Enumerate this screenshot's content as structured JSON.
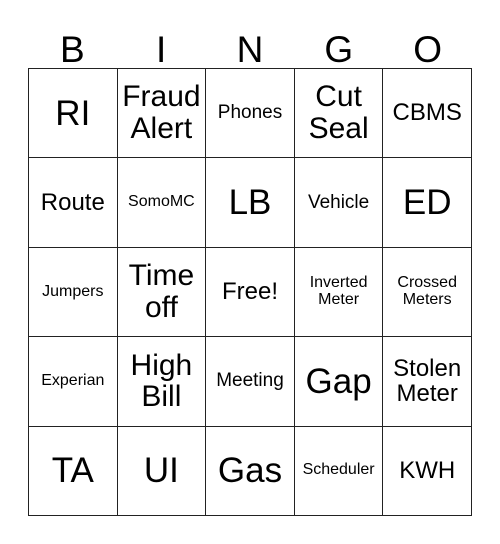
{
  "card": {
    "header_letters": [
      "B",
      "I",
      "N",
      "G",
      "O"
    ],
    "rows": [
      [
        {
          "text": "RI",
          "size": "fs-xl"
        },
        {
          "text": "Fraud\nAlert",
          "size": "fs-lg"
        },
        {
          "text": "Phones",
          "size": "fs-sm"
        },
        {
          "text": "Cut\nSeal",
          "size": "fs-lg"
        },
        {
          "text": "CBMS",
          "size": "fs-md"
        }
      ],
      [
        {
          "text": "Route",
          "size": "fs-md"
        },
        {
          "text": "SomoMC",
          "size": "fs-xs"
        },
        {
          "text": "LB",
          "size": "fs-xl"
        },
        {
          "text": "Vehicle",
          "size": "fs-sm"
        },
        {
          "text": "ED",
          "size": "fs-xl"
        }
      ],
      [
        {
          "text": "Jumpers",
          "size": "fs-xs"
        },
        {
          "text": "Time\noff",
          "size": "fs-lg"
        },
        {
          "text": "Free!",
          "size": "fs-md"
        },
        {
          "text": "Inverted\nMeter",
          "size": "fs-xs"
        },
        {
          "text": "Crossed\nMeters",
          "size": "fs-xs"
        }
      ],
      [
        {
          "text": "Experian",
          "size": "fs-xs"
        },
        {
          "text": "High\nBill",
          "size": "fs-lg"
        },
        {
          "text": "Meeting",
          "size": "fs-sm"
        },
        {
          "text": "Gap",
          "size": "fs-xl"
        },
        {
          "text": "Stolen\nMeter",
          "size": "fs-md"
        }
      ],
      [
        {
          "text": "TA",
          "size": "fs-xl"
        },
        {
          "text": "UI",
          "size": "fs-xl"
        },
        {
          "text": "Gas",
          "size": "fs-xl"
        },
        {
          "text": "Scheduler",
          "size": "fs-xs"
        },
        {
          "text": "KWH",
          "size": "fs-md"
        }
      ]
    ],
    "colors": {
      "border": "#222222",
      "text": "#000000",
      "background": "#ffffff"
    }
  }
}
